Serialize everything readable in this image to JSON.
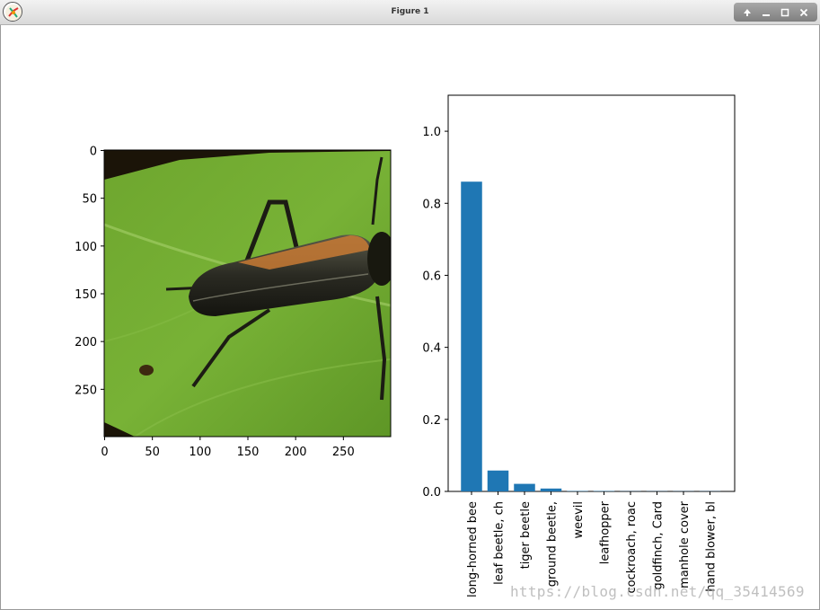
{
  "window": {
    "title": "Figure 1"
  },
  "image_panel": {
    "x_ticks": [
      "0",
      "50",
      "100",
      "150",
      "200",
      "250"
    ],
    "y_ticks": [
      "0",
      "50",
      "100",
      "150",
      "200",
      "250"
    ]
  },
  "chart_data": {
    "type": "bar",
    "categories": [
      "long-horned bee",
      "leaf beetle, ch",
      "tiger beetle",
      "ground beetle,",
      "weevil",
      "leafhopper",
      "cockroach, roac",
      "goldfinch, Card",
      "manhole cover",
      "hand blower, bl"
    ],
    "values": [
      0.86,
      0.058,
      0.021,
      0.008,
      0.001,
      0.001,
      0.0005,
      0.0005,
      0.0005,
      0.0005
    ],
    "ylim": [
      0,
      1.1
    ],
    "y_ticks": [
      "0.0",
      "0.2",
      "0.4",
      "0.6",
      "0.8",
      "1.0"
    ],
    "bar_color": "#1f77b4"
  },
  "watermark": "https://blog.csdn.net/qq_35414569"
}
